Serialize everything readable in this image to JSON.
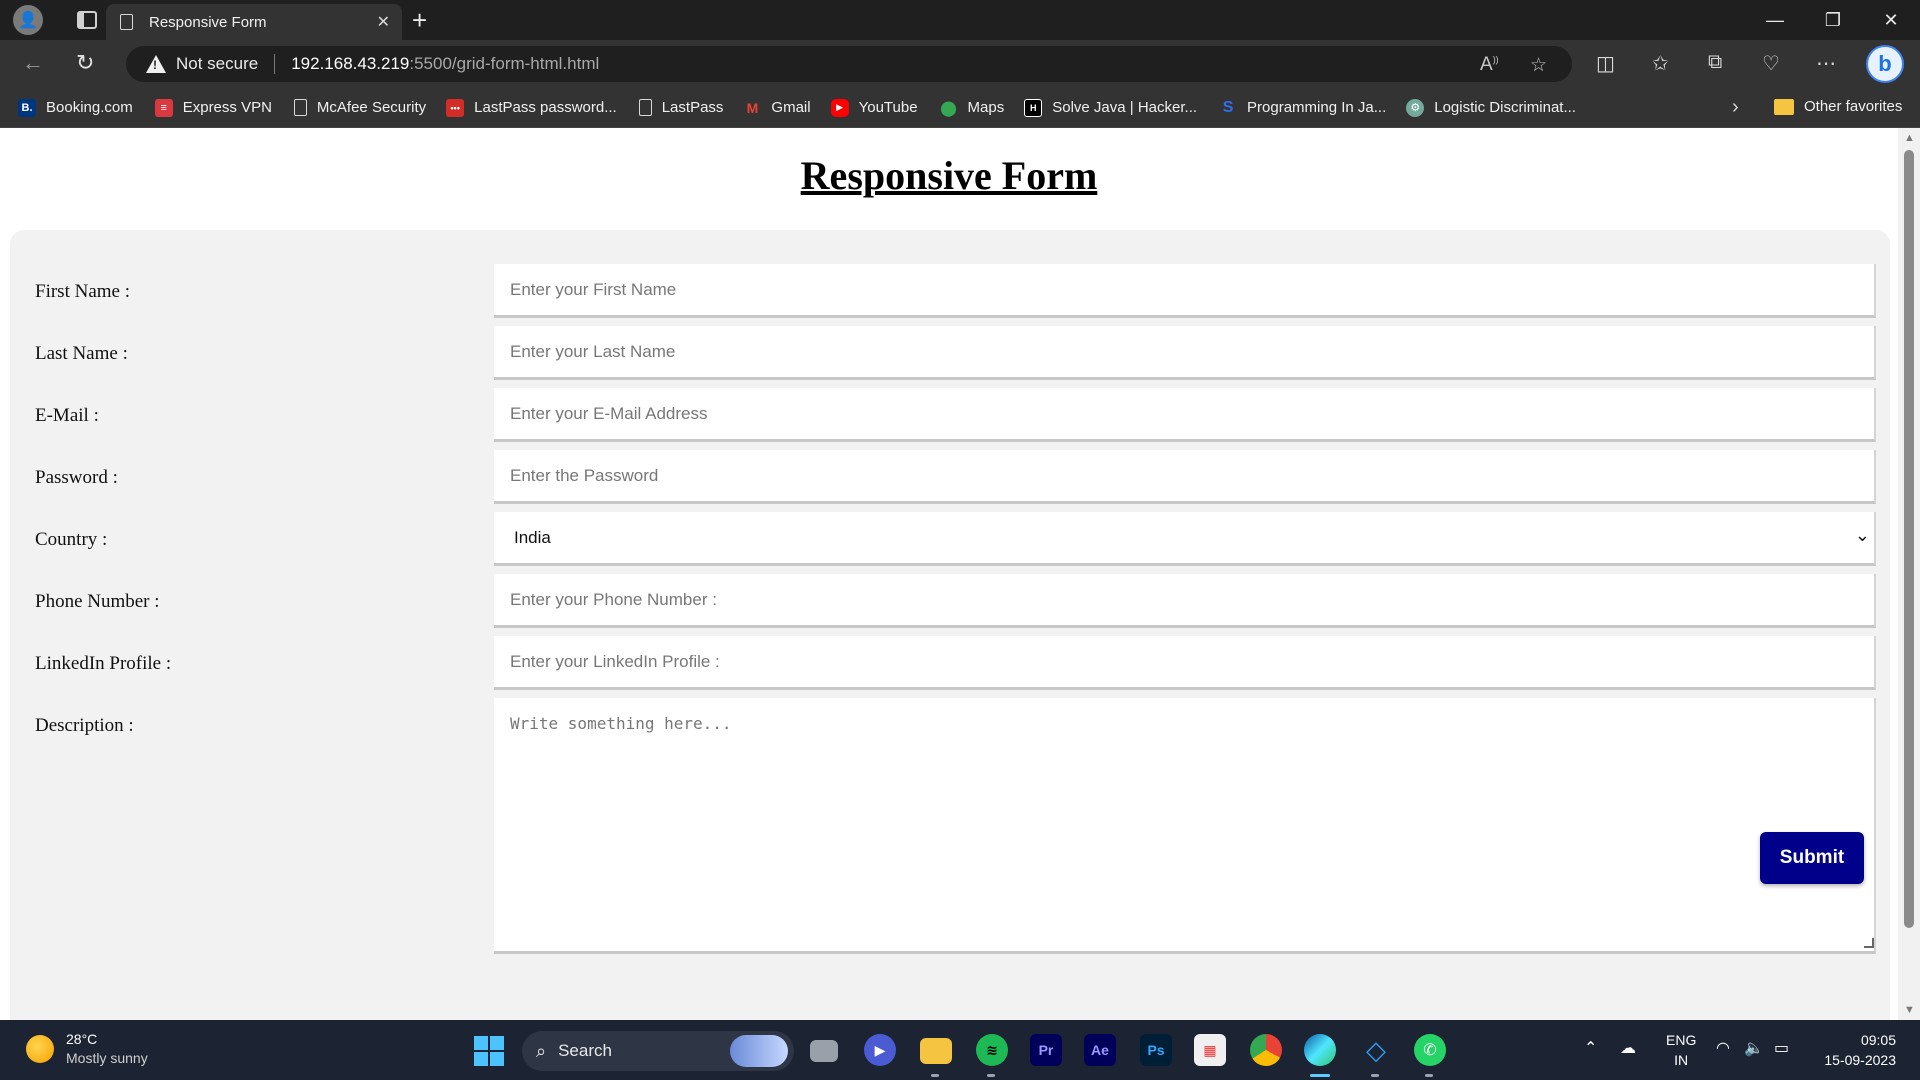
{
  "browser": {
    "tab_title": "Responsive Form",
    "security_label": "Not secure",
    "url_host": "192.168.43.219",
    "url_rest": ":5500/grid-form-html.html",
    "bookmarks": [
      {
        "label": "Booking.com",
        "icon": "booking-icon",
        "color": "#003580",
        "glyph": "B."
      },
      {
        "label": "Express VPN",
        "icon": "expressvpn-icon",
        "color": "#da3940",
        "glyph": "≡"
      },
      {
        "label": "McAfee Security",
        "icon": "page-icon",
        "color": "",
        "glyph": ""
      },
      {
        "label": "LastPass password...",
        "icon": "lastpass-icon",
        "color": "#d32d27",
        "glyph": "•••"
      },
      {
        "label": "LastPass",
        "icon": "page-icon",
        "color": "",
        "glyph": ""
      },
      {
        "label": "Gmail",
        "icon": "gmail-icon",
        "color": "#333333",
        "glyph": "M"
      },
      {
        "label": "YouTube",
        "icon": "youtube-icon",
        "color": "#ff0000",
        "glyph": "▶"
      },
      {
        "label": "Maps",
        "icon": "maps-icon",
        "color": "#333333",
        "glyph": "📍"
      },
      {
        "label": "Solve Java | Hacker...",
        "icon": "hackerrank-icon",
        "color": "#000000",
        "glyph": "H"
      },
      {
        "label": "Programming In Ja...",
        "icon": "s-icon",
        "color": "#333333",
        "glyph": "S"
      },
      {
        "label": "Logistic Discriminat...",
        "icon": "chatgpt-icon",
        "color": "#74aa9c",
        "glyph": "⚙"
      }
    ],
    "other_favorites": "Other favorites"
  },
  "page": {
    "title": "Responsive Form",
    "fields": {
      "first_name": {
        "label": "First Name :",
        "placeholder": "Enter your First Name"
      },
      "last_name": {
        "label": "Last Name :",
        "placeholder": "Enter your Last Name"
      },
      "email": {
        "label": "E-Mail :",
        "placeholder": "Enter your E-Mail Address"
      },
      "password": {
        "label": "Password :",
        "placeholder": "Enter the Password"
      },
      "country": {
        "label": "Country :",
        "value": "India"
      },
      "phone": {
        "label": "Phone Number :",
        "placeholder": "Enter your Phone Number :"
      },
      "linkedin": {
        "label": "LinkedIn Profile :",
        "placeholder": "Enter your LinkedIn Profile :"
      },
      "description": {
        "label": "Description :",
        "placeholder": "Write something here..."
      }
    },
    "submit_label": "Submit",
    "submit_color": "#00008b"
  },
  "taskbar": {
    "weather_temp": "28°C",
    "weather_desc": "Mostly sunny",
    "search_label": "Search",
    "lang_line1": "ENG",
    "lang_line2": "IN",
    "time": "09:05",
    "date": "15-09-2023",
    "apps": [
      {
        "name": "file-explorer-icon"
      },
      {
        "name": "zoom-icon"
      },
      {
        "name": "folder-icon"
      },
      {
        "name": "spotify-icon",
        "glyph": "≋"
      },
      {
        "name": "premiere-pro-icon",
        "glyph": "Pr"
      },
      {
        "name": "after-effects-icon",
        "glyph": "Ae"
      },
      {
        "name": "photoshop-icon",
        "glyph": "Ps"
      },
      {
        "name": "microsoft-store-icon"
      },
      {
        "name": "chrome-icon"
      },
      {
        "name": "edge-icon"
      },
      {
        "name": "vscode-icon",
        "glyph": "◇"
      },
      {
        "name": "whatsapp-icon",
        "glyph": "✆"
      }
    ]
  }
}
